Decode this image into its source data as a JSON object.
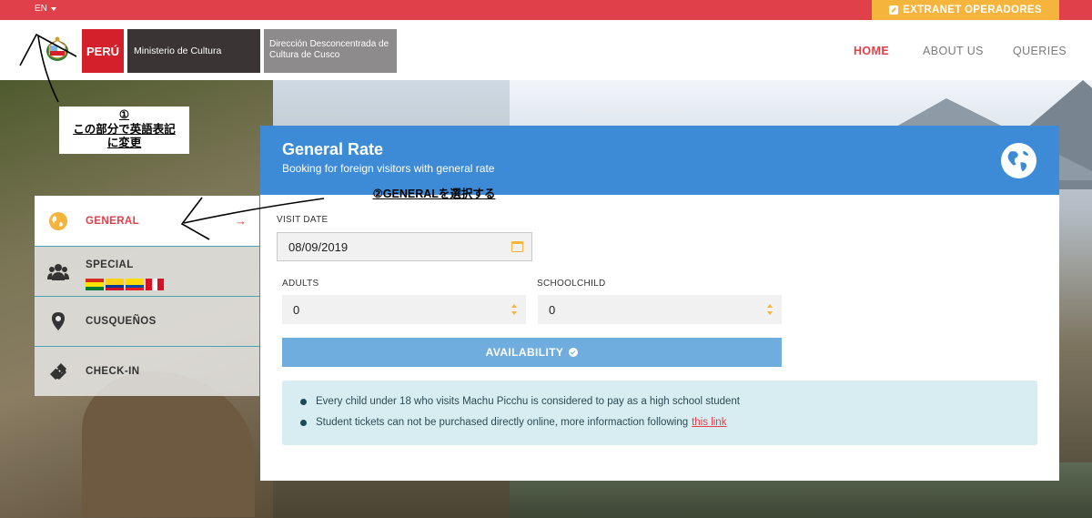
{
  "topbar": {
    "language": "EN",
    "extranet_label": "EXTRANET OPERADORES"
  },
  "header": {
    "peru_label": "PERÚ",
    "ministry_label": "Ministerio de Cultura",
    "direction_label": "Dirección Desconcentrada de Cultura de Cusco",
    "nav": [
      "HOME",
      "ABOUT US",
      "QUERIES"
    ],
    "active_nav": "HOME"
  },
  "annotations": {
    "note1": "①\nこの部分で英語表記\nに変更",
    "note2": "②GENERALを選択する"
  },
  "side_menu": [
    {
      "label": "GENERAL",
      "icon": "globe-icon",
      "active": true
    },
    {
      "label": "SPECIAL",
      "icon": "group-icon",
      "active": false
    },
    {
      "label": "CUSQUEÑOS",
      "icon": "map-pin-icon",
      "active": false
    },
    {
      "label": "CHECK-IN",
      "icon": "ticket-icon",
      "active": false
    }
  ],
  "card": {
    "title": "General Rate",
    "subtitle": "Booking for foreign visitors with general rate",
    "visit_date_label": "VISIT DATE",
    "visit_date_value": "08/09/2019",
    "adults_label": "ADULTS",
    "adults_value": "0",
    "schoolchild_label": "SCHOOLCHILD",
    "schoolchild_value": "0",
    "availability_button": "AVAILABILITY",
    "info": [
      "Every child under 18 who visits Machu Picchu is considered to pay as a high school student",
      "Student tickets can not be purchased directly online, more informaction following"
    ],
    "info_link": "this link"
  },
  "colors": {
    "brand_red": "#e0404a",
    "accent_yellow": "#f5b43b",
    "header_blue": "#3d8bd6",
    "button_blue": "#70addf",
    "info_bg": "#d7edf1"
  }
}
